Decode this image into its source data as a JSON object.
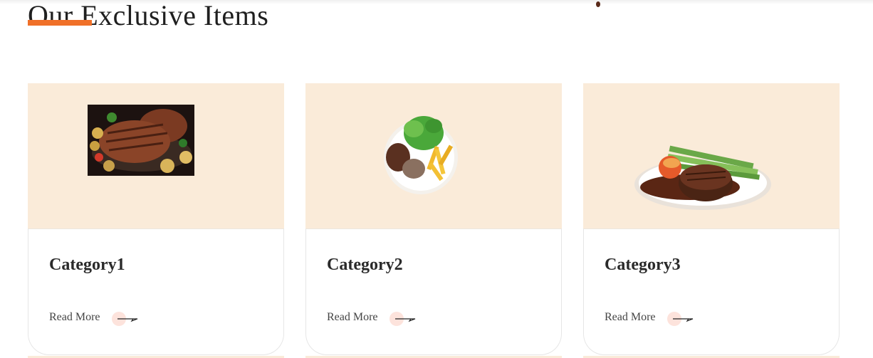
{
  "section": {
    "title": "Our Exclusive Items"
  },
  "cards": [
    {
      "title": "Category1",
      "link_label": "Read More",
      "image_icon": "steak-with-potatoes-image"
    },
    {
      "title": "Category2",
      "link_label": "Read More",
      "image_icon": "plate-with-salad-steak-fries-image"
    },
    {
      "title": "Category3",
      "link_label": "Read More",
      "image_icon": "steak-with-asparagus-image"
    }
  ],
  "colors": {
    "accent": "#f07028",
    "card_image_bg": "#faebd9",
    "arrow_circle": "#fde3dc"
  }
}
